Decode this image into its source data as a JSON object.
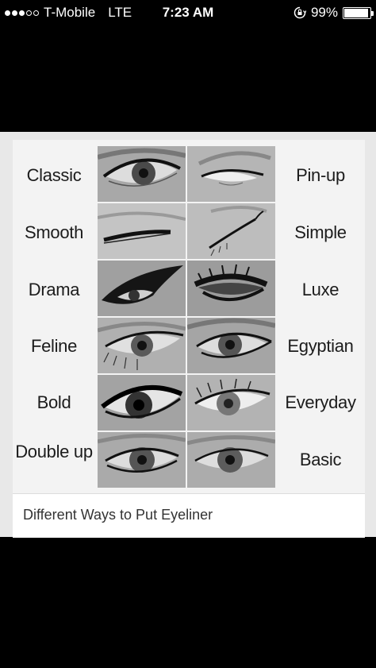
{
  "status_bar": {
    "signal": {
      "filled": 3,
      "total": 5
    },
    "carrier": "T-Mobile",
    "network": "LTE",
    "time": "7:23 AM",
    "battery_text": "99%",
    "battery_level": 0.99
  },
  "pin": {
    "caption": "Different Ways to Put Eyeliner",
    "left_styles": [
      "Classic",
      "Smooth",
      "Drama",
      "Feline",
      "Bold",
      "Double up"
    ],
    "right_styles": [
      "Pin-up",
      "Simple",
      "Luxe",
      "Egyptian",
      "Everyday",
      "Basic"
    ]
  },
  "colors": {
    "background": "#000000",
    "card": "#f3f3f3",
    "text": "#1c1c1c"
  }
}
